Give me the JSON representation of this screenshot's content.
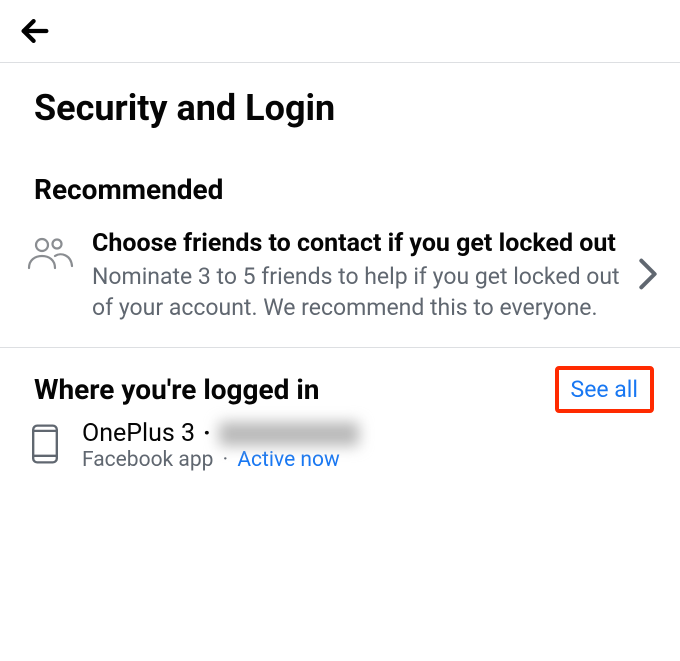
{
  "header": {
    "back_icon": "back-arrow"
  },
  "page_title": "Security and Login",
  "recommended": {
    "heading": "Recommended",
    "item": {
      "icon": "friends-icon",
      "title": "Choose friends to contact if you get locked out",
      "subtitle": "Nominate 3 to 5 friends to help if you get locked out of your account. We recommend this to everyone.",
      "chevron_icon": "chevron-right"
    }
  },
  "logged_in": {
    "heading": "Where you're logged in",
    "see_all_label": "See all",
    "device": {
      "icon": "phone-icon",
      "name": "OnePlus 3",
      "separator": "·",
      "location_redacted": true,
      "app_label": "Facebook app",
      "status_separator": "·",
      "status": "Active now"
    }
  }
}
